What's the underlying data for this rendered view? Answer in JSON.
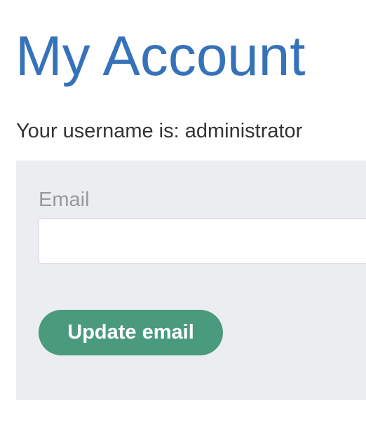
{
  "page": {
    "title": "My Account",
    "username_text": "Your username is: administrator"
  },
  "form": {
    "email_label": "Email",
    "email_value": "",
    "update_button_label": "Update email"
  },
  "colors": {
    "title": "#3572ba",
    "panel_background": "#ebedf0",
    "button_background": "#4a9a7e",
    "label_text": "#999999"
  }
}
